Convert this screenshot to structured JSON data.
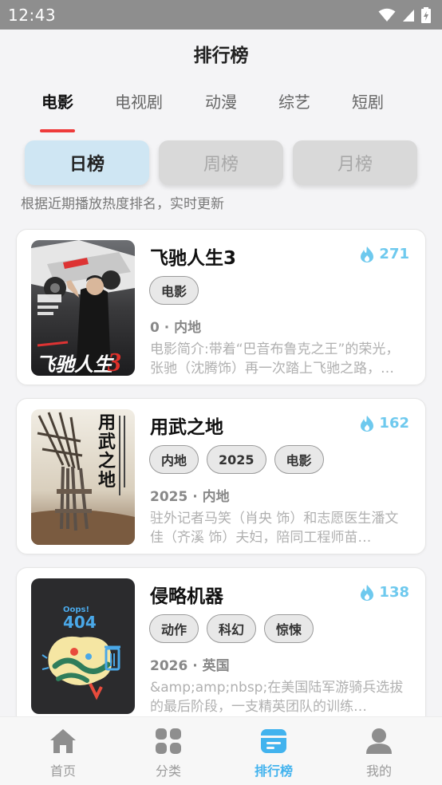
{
  "status_bar": {
    "time": "12:43"
  },
  "header": {
    "title": "排行榜"
  },
  "category_tabs": [
    {
      "label": "电影",
      "active": true
    },
    {
      "label": "电视剧",
      "active": false
    },
    {
      "label": "动漫",
      "active": false
    },
    {
      "label": "综艺",
      "active": false
    },
    {
      "label": "短剧",
      "active": false
    }
  ],
  "period_tabs": [
    {
      "label": "日榜",
      "active": true
    },
    {
      "label": "周榜",
      "active": false
    },
    {
      "label": "月榜",
      "active": false
    }
  ],
  "description": "根据近期播放热度排名，实时更新",
  "items": [
    {
      "title": "飞驰人生3",
      "heat": "271",
      "tags": [
        "电影"
      ],
      "meta": "0 · 内地",
      "synopsis": "电影简介:带着“巴音布鲁克之王”的荣光，张驰（沈腾饰）再一次踏上飞驰之路，参加史上最残酷的赛事。",
      "poster_text": "飞驰人生3"
    },
    {
      "title": "用武之地",
      "heat": "162",
      "tags": [
        "内地",
        "2025",
        "电影"
      ],
      "meta": "2025 · 内地",
      "synopsis": "驻外记者马笑（肖央 饰）和志愿医生潘文佳（齐溪 饰）夫妇，陪同工程师苗…",
      "poster_text": "用武之地"
    },
    {
      "title": "侵略机器",
      "heat": "138",
      "tags": [
        "动作",
        "科幻",
        "惊悚"
      ],
      "meta": "2026 · 英国",
      "synopsis": "&amp;amp;nbsp;在美国陆军游骑兵选拔的最后阶段，一支精英团队的训练…",
      "poster_text": "Oops! 404"
    }
  ],
  "bottom_nav": [
    {
      "label": "首页",
      "icon": "home-icon",
      "active": false
    },
    {
      "label": "分类",
      "icon": "grid-icon",
      "active": false
    },
    {
      "label": "排行榜",
      "icon": "ranking-icon",
      "active": true
    },
    {
      "label": "我的",
      "icon": "profile-icon",
      "active": false
    }
  ],
  "colors": {
    "accent": "#42b3ee",
    "heat": "#6ec9ee",
    "tab_underline": "#ee3b3b",
    "active_period_bg": "#cfe6f3"
  }
}
